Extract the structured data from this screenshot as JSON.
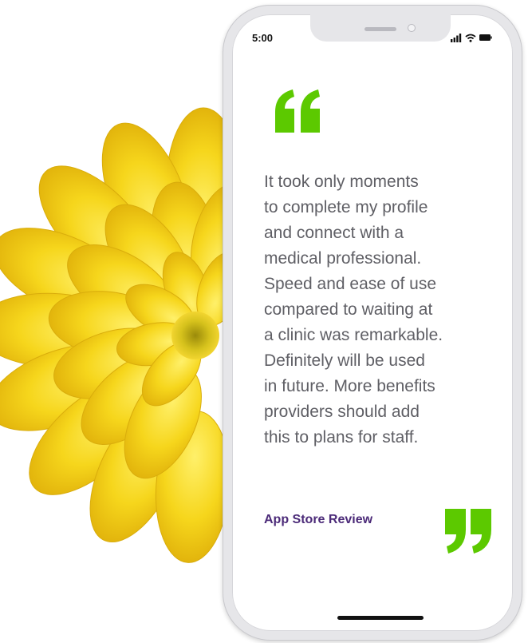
{
  "status_bar": {
    "time": "5:00",
    "icons": [
      "signal-icon",
      "wifi-icon",
      "battery-icon"
    ]
  },
  "review": {
    "lines": [
      "It took only moments",
      "to complete my profile",
      "and connect with a",
      "medical professional.",
      "Speed and ease of use",
      "compared to waiting at",
      "a clinic was remarkable.",
      "Definitely will be used",
      "in future. More benefits",
      "providers should add",
      "this to plans for staff."
    ],
    "source": "App Store Review"
  },
  "colors": {
    "quote_green": "#5cc900",
    "source_purple": "#4b2a78",
    "body_text": "#5f5f65",
    "flower_yellow": "#f5d21a"
  }
}
